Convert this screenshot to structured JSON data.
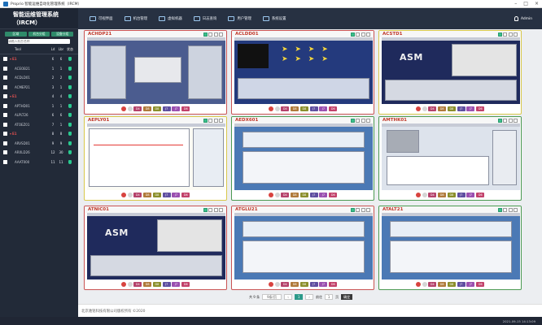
{
  "window": {
    "title": "Proprio 智能运维自动化管理系统（IRCM）",
    "controls": [
      "–",
      "□",
      "×"
    ]
  },
  "sidebar": {
    "brand": "智能运维管理系统（IRCM）",
    "tabs": [
      "区域",
      "机台分组",
      "设备分组"
    ],
    "search_placeholder": "请输入机台名称",
    "columns": {
      "name": "Tool",
      "ln": "Ld",
      "lnr": "Lbr",
      "status": "状态"
    },
    "rows": [
      {
        "type": "group",
        "name": "E1",
        "ld": "6",
        "lbr": "6"
      },
      {
        "type": "item",
        "name": "ACEOB21",
        "ld": "1",
        "lbr": "1"
      },
      {
        "type": "item",
        "name": "ACDLD01",
        "ld": "2",
        "lbr": "2"
      },
      {
        "type": "item",
        "name": "ACMEP21",
        "ld": "3",
        "lbr": "1"
      },
      {
        "type": "group",
        "name": "E1",
        "ld": "4",
        "lbr": "4"
      },
      {
        "type": "item",
        "name": "APTHD01",
        "ld": "1",
        "lbr": "1"
      },
      {
        "type": "item",
        "name": "ALPLT26",
        "ld": "6",
        "lbr": "6"
      },
      {
        "type": "item",
        "name": "ATOEZ01",
        "ld": "7",
        "lbr": "1"
      },
      {
        "type": "group",
        "name": "E1",
        "ld": "8",
        "lbr": "8"
      },
      {
        "type": "item",
        "name": "ARVSD01",
        "ld": "9",
        "lbr": "9"
      },
      {
        "type": "item",
        "name": "ARXLD26",
        "ld": "12",
        "lbr": "30"
      },
      {
        "type": "item",
        "name": "AAAT000",
        "ld": "11",
        "lbr": "11"
      }
    ]
  },
  "topnav": {
    "items": [
      {
        "label": "可视界面",
        "icon": "monitor-icon"
      },
      {
        "label": "机台管理",
        "icon": "cluster-icon"
      },
      {
        "label": "虚拟机器",
        "icon": "clock-icon"
      },
      {
        "label": "日志查询",
        "icon": "chat-icon"
      },
      {
        "label": "用户管理",
        "icon": "users-icon"
      },
      {
        "label": "系统设置",
        "icon": "settings-icon"
      }
    ],
    "user": "Admin"
  },
  "tiles": [
    {
      "name": "ACHDP21",
      "status": "error",
      "variant": "pop"
    },
    {
      "name": "ACLDD01",
      "status": "error",
      "variant": "arrows"
    },
    {
      "name": "ACSTD1",
      "status": "warn",
      "variant": "asm"
    },
    {
      "name": "AEPLY01",
      "status": "warn",
      "variant": "sheet"
    },
    {
      "name": "AEDX601",
      "status": "ok",
      "variant": "form"
    },
    {
      "name": "AMTHK01",
      "status": "ok",
      "variant": "plot"
    },
    {
      "name": "ATNIC01",
      "status": "error",
      "variant": "asm"
    },
    {
      "name": "ATGLU21",
      "status": "error",
      "variant": "form"
    },
    {
      "name": "ATALT21",
      "status": "ok",
      "variant": "form"
    }
  ],
  "tile_actions": [
    {
      "label": "",
      "kind": "alert"
    },
    {
      "label": "",
      "kind": "power"
    },
    {
      "label": "D4",
      "color": "#b5426b"
    },
    {
      "label": "D8",
      "color": "#b07a3a"
    },
    {
      "label": "D8",
      "color": "#8b8f2b"
    },
    {
      "label": "J7",
      "color": "#5e4ea0"
    },
    {
      "label": "J7",
      "color": "#9a4fb0"
    },
    {
      "label": "D6",
      "color": "#c2416a"
    }
  ],
  "tile_sample_text": {
    "logo": "ASM",
    "arrows_row": "➤ ➤ ➤ ➤"
  },
  "pager": {
    "total_label": "共 9 条",
    "size": "9条/页",
    "prev": "‹",
    "current": "1",
    "next": "›",
    "jump_label": "前往",
    "jump_value": "1",
    "page_suffix": "页",
    "go": "确定"
  },
  "footer": {
    "text": "北京驰铭科技有限公司版权所有 ©2020"
  },
  "statusbar": {
    "text": "2021-09-15 14:13:09"
  }
}
